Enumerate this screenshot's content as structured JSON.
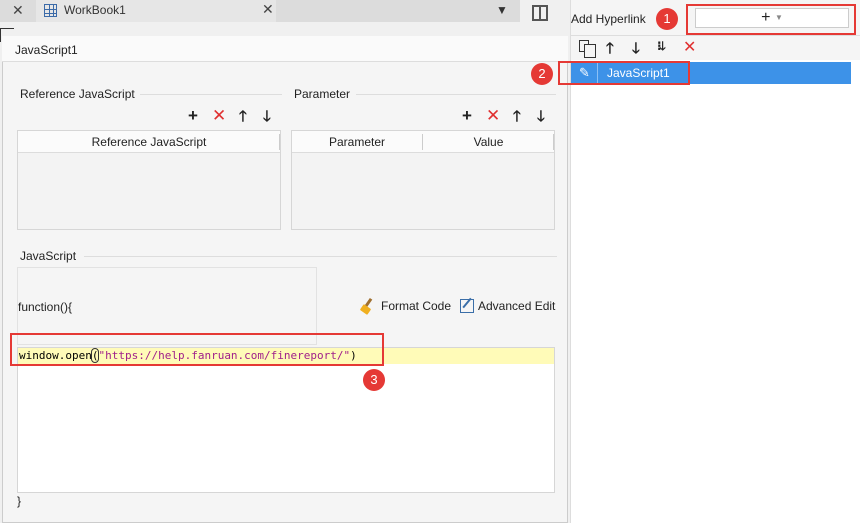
{
  "tabs": {
    "workbook_title": "WorkBook1"
  },
  "dialog": {
    "title": "JavaScript1",
    "reference_section_label": "Reference JavaScript",
    "reference_table": {
      "columns": [
        "Reference JavaScript"
      ]
    },
    "parameter_section_label": "Parameter",
    "parameter_table": {
      "columns": [
        "Parameter",
        "Value"
      ]
    },
    "javascript_section_label": "JavaScript",
    "function_header": "function(){",
    "format_code_label": "Format Code",
    "advanced_edit_label": "Advanced Edit",
    "code": {
      "before": "window.open",
      "paren": "(",
      "string": "\"https://help.fanruan.com/finereport/\"",
      "after": ")"
    },
    "closing_brace": "}"
  },
  "hyperlink_panel": {
    "title": "Add Hyperlink",
    "add_symbol": "+",
    "items": [
      {
        "label": "JavaScript1"
      }
    ]
  },
  "annotations": {
    "badge_1": "1",
    "badge_2": "2",
    "badge_3": "3",
    "color": "#e53935"
  },
  "colors": {
    "selected_row": "#3d92e8",
    "delete_red": "#e03030",
    "code_highlight": "#fffbb8",
    "code_string": "#a0208a"
  }
}
